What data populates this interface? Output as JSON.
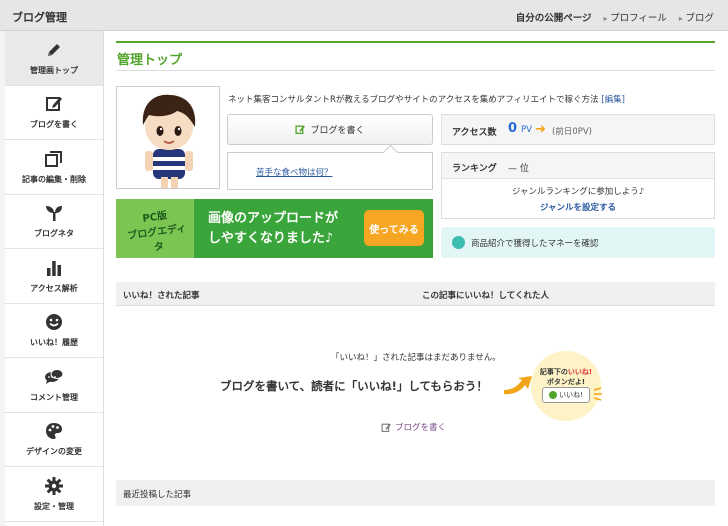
{
  "topbar": {
    "title": "ブログ管理",
    "my_page": "自分の公開ページ",
    "links": [
      "プロフィール",
      "ブログ"
    ]
  },
  "sidebar": {
    "items": [
      {
        "label": "管理画トップ",
        "icon": "pencil-icon",
        "active": true
      },
      {
        "label": "ブログを書く",
        "icon": "edit-square-icon"
      },
      {
        "label": "記事の編集・削除",
        "icon": "folders-icon"
      },
      {
        "label": "ブログネタ",
        "icon": "sprout-icon"
      },
      {
        "label": "アクセス解析",
        "icon": "bar-chart-icon"
      },
      {
        "label": "いいね！履歴",
        "icon": "smiley-icon"
      },
      {
        "label": "コメント管理",
        "icon": "speech-bubbles-icon"
      },
      {
        "label": "デザインの変更",
        "icon": "palette-icon"
      },
      {
        "label": "設定・管理",
        "icon": "gear-icon"
      }
    ]
  },
  "main": {
    "title": "管理トップ",
    "description": "ネット集客コンサルタントRが教えるブログやサイトのアクセスを集めアフィリエイトで稼ぐ方法",
    "edit_link": "[編集]",
    "write_button": "ブログを書く",
    "question": "苦手な食べ物は何？",
    "banner": {
      "badge_line1": "PC版",
      "badge_line2": "ブログエディタ",
      "line1": "画像のアップロードが",
      "line2": "しやすくなりました♪",
      "button": "使ってみる"
    },
    "access": {
      "label": "アクセス数",
      "value": "0",
      "unit": "PV",
      "previous": "(前日0PV)"
    },
    "ranking": {
      "label": "ランキング",
      "value": "— 位",
      "join": "ジャンルランキングに参加しよう♪",
      "set_genre": "ジャンルを設定する"
    },
    "money_link": "商品紹介で獲得したマネーを確認",
    "likes_table": {
      "col1": "いいね！された記事",
      "col2": "この記事にいいね！してくれた人"
    },
    "empty_message": "「いいね！」された記事はまだありません。",
    "cta": "ブログを書いて、読者に「いいね!」してもらおう！",
    "bubble": {
      "line1a": "記事下の",
      "line1b": "いいね!",
      "line2a": "ボタン",
      "line2b": "だよ!",
      "pill": "いいね!"
    },
    "write_link": "ブログを書く",
    "recent_header": "最近投稿した記事"
  },
  "colors": {
    "accent": "#52a52d",
    "link": "#2c5aa0",
    "banner": "#3aa53a",
    "access_number": "#2a6ad8"
  }
}
